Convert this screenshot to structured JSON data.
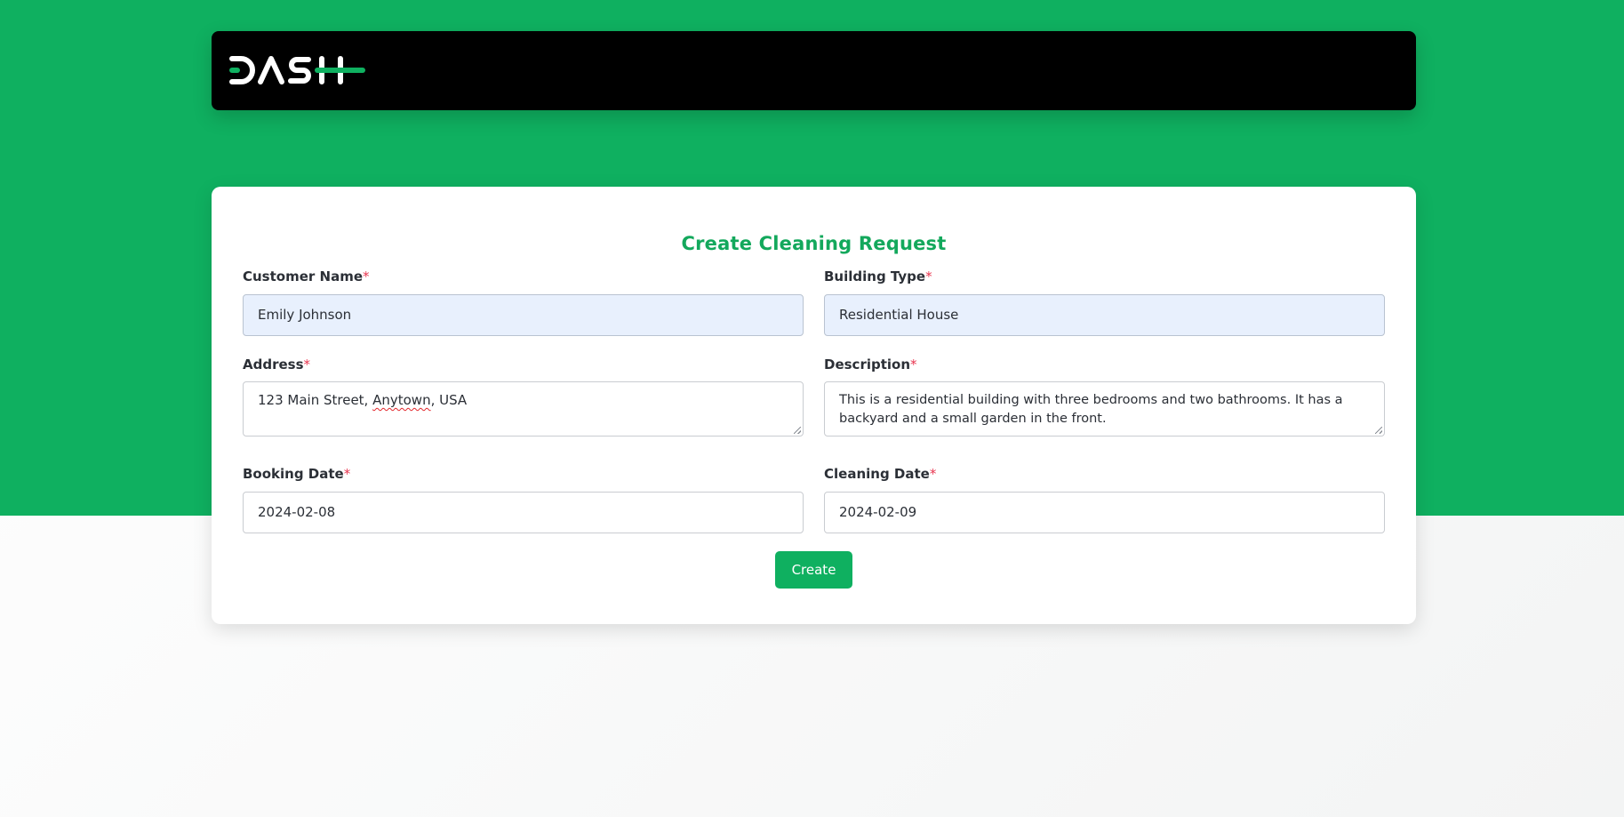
{
  "navbar": {
    "logo_text": "DASH",
    "logo_accent_color": "#0fb060"
  },
  "form": {
    "title": "Create Cleaning Request",
    "required_marker": "*",
    "fields": {
      "customer_name": {
        "label": "Customer Name",
        "value": "Emily Johnson"
      },
      "building_type": {
        "label": "Building Type",
        "value": "Residential House"
      },
      "address": {
        "label": "Address",
        "value_before": "123 Main Street, ",
        "value_misspelled": "Anytown",
        "value_after": ", USA"
      },
      "description": {
        "label": "Description",
        "value": "This is a residential building with three bedrooms and two bathrooms. It has a backyard and a small garden in the front."
      },
      "booking_date": {
        "label": "Booking Date",
        "value": "2024-02-08"
      },
      "cleaning_date": {
        "label": "Cleaning Date",
        "value": "2024-02-09"
      }
    },
    "submit_label": "Create"
  },
  "colors": {
    "brand_green": "#0fb060",
    "title_green": "#13a85c",
    "required_red": "#e8354f",
    "autofill_blue": "#e8f0fd"
  }
}
